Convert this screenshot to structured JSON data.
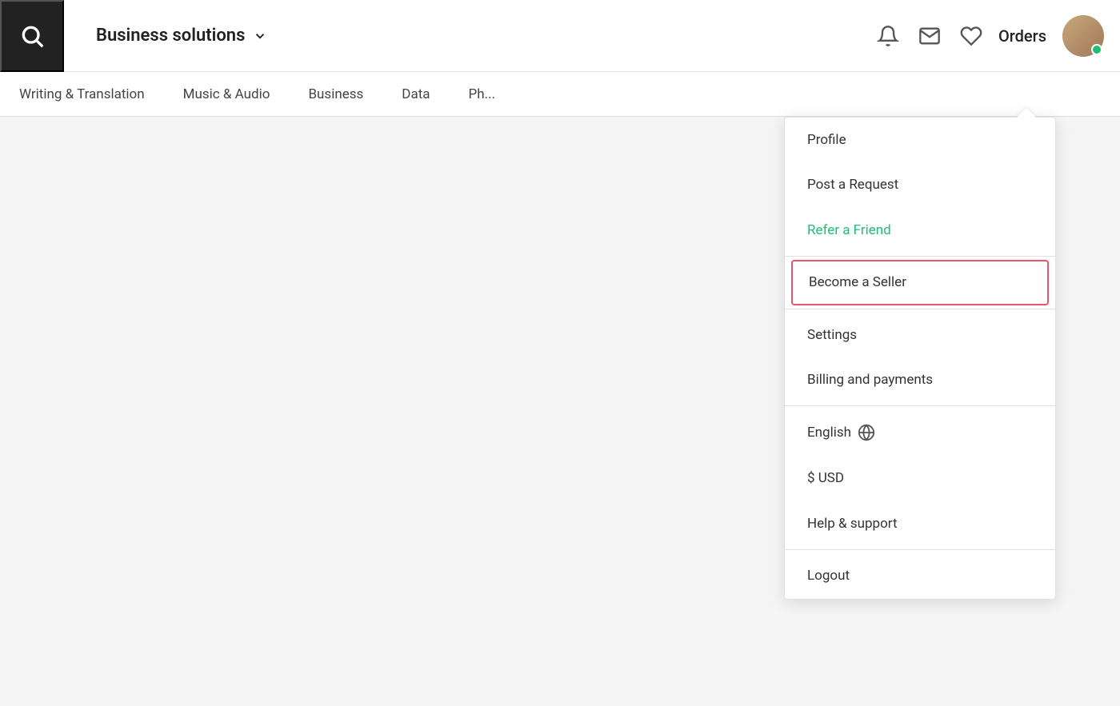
{
  "header": {
    "business_solutions_label": "Business solutions",
    "orders_label": "Orders",
    "online_status": "online"
  },
  "navbar": {
    "items": [
      {
        "label": "Writing & Translation"
      },
      {
        "label": "Music & Audio"
      },
      {
        "label": "Business"
      },
      {
        "label": "Data"
      },
      {
        "label": "Ph..."
      }
    ]
  },
  "dropdown": {
    "items": [
      {
        "id": "profile",
        "label": "Profile",
        "style": "normal",
        "divider_after": false
      },
      {
        "id": "post-request",
        "label": "Post a Request",
        "style": "normal",
        "divider_after": false
      },
      {
        "id": "refer-friend",
        "label": "Refer a Friend",
        "style": "green",
        "divider_after": false
      },
      {
        "id": "become-seller",
        "label": "Become a Seller",
        "style": "highlighted",
        "divider_after": false
      },
      {
        "id": "settings",
        "label": "Settings",
        "style": "normal",
        "divider_after": false
      },
      {
        "id": "billing",
        "label": "Billing and payments",
        "style": "normal",
        "divider_after": true
      },
      {
        "id": "english",
        "label": "English",
        "style": "language",
        "divider_after": false
      },
      {
        "id": "usd",
        "label": "$ USD",
        "style": "normal",
        "divider_after": false
      },
      {
        "id": "help",
        "label": "Help & support",
        "style": "normal",
        "divider_after": true
      },
      {
        "id": "logout",
        "label": "Logout",
        "style": "normal",
        "divider_after": false
      }
    ]
  }
}
